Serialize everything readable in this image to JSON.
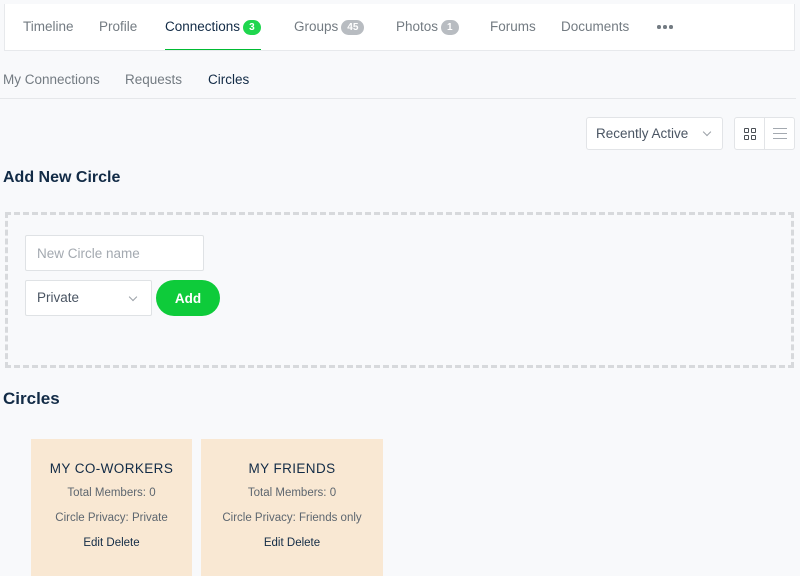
{
  "topnav": {
    "items": [
      {
        "label": "Timeline",
        "count": null,
        "active": false
      },
      {
        "label": "Profile",
        "count": null,
        "active": false
      },
      {
        "label": "Connections",
        "count": "3",
        "active": true
      },
      {
        "label": "Groups",
        "count": "45",
        "active": false
      },
      {
        "label": "Photos",
        "count": "1",
        "active": false
      },
      {
        "label": "Forums",
        "count": null,
        "active": false
      },
      {
        "label": "Documents",
        "count": null,
        "active": false
      }
    ],
    "more_icon": "more-horizontal-icon"
  },
  "subnav": {
    "items": [
      {
        "label": "My Connections",
        "active": false
      },
      {
        "label": "Requests",
        "active": false
      },
      {
        "label": "Circles",
        "active": true
      }
    ]
  },
  "sort": {
    "selected": "Recently Active"
  },
  "view_toggle": {
    "grid_icon": "grid-view-icon",
    "list_icon": "list-view-icon",
    "active": "grid"
  },
  "add_circle": {
    "heading": "Add New Circle",
    "name_placeholder": "New Circle name",
    "name_value": "",
    "privacy_selected": "Private",
    "add_label": "Add"
  },
  "circles": {
    "heading": "Circles",
    "items": [
      {
        "title": "MY CO-WORKERS",
        "members": "Total Members: 0",
        "privacy": "Circle Privacy: Private",
        "edit": "Edit",
        "delete": "Delete"
      },
      {
        "title": "MY FRIENDS",
        "members": "Total Members: 0",
        "privacy": "Circle Privacy: Friends only",
        "edit": "Edit",
        "delete": "Delete"
      }
    ]
  },
  "colors": {
    "accent": "#00bb33",
    "add_button": "#0ecb3a",
    "card_bg": "#f9e8d3",
    "text": "#122b46",
    "muted": "#737b82"
  }
}
